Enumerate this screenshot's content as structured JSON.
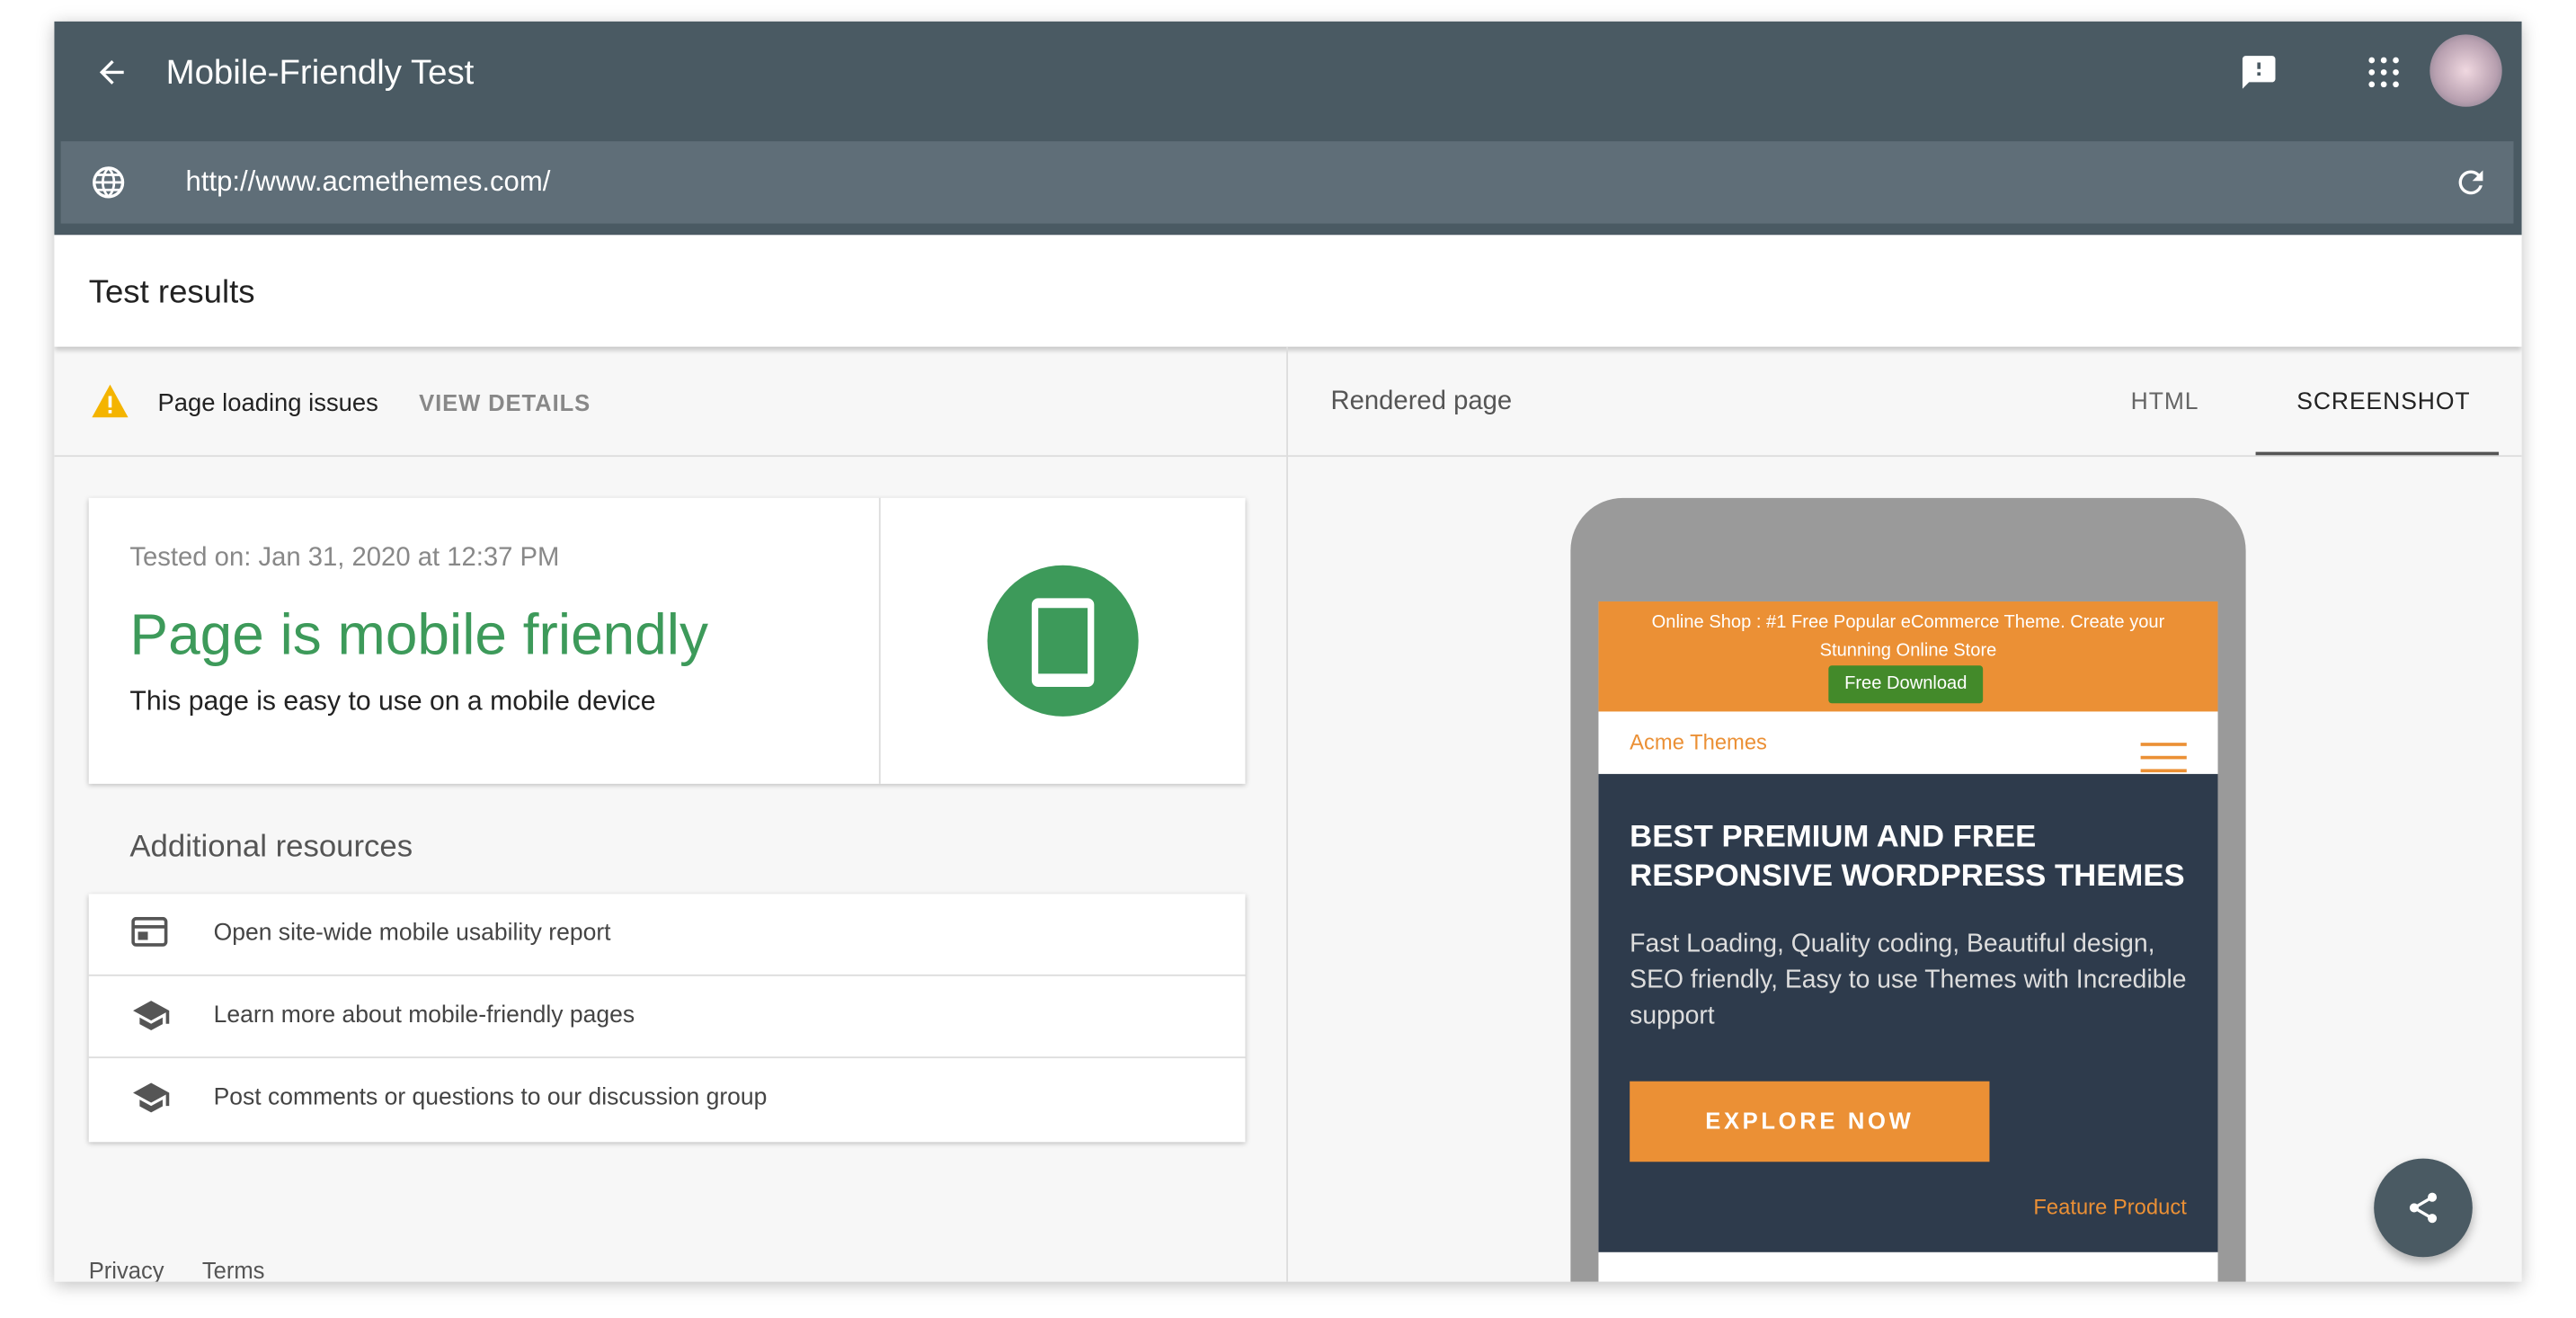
{
  "header": {
    "title": "Mobile-Friendly Test",
    "back_icon": "arrow-left-icon",
    "feedback_icon": "feedback-icon",
    "apps_icon": "apps-grid-icon"
  },
  "url_bar": {
    "value": "http://www.acmethemes.com/",
    "globe_icon": "globe-icon",
    "reload_icon": "reload-icon"
  },
  "results": {
    "title": "Test results"
  },
  "issues": {
    "label": "Page loading issues",
    "action": "VIEW DETAILS",
    "warning_color": "#f4b400"
  },
  "result_card": {
    "tested_on": "Tested on: Jan 31, 2020 at 12:37 PM",
    "headline": "Page is mobile friendly",
    "subtext": "This page is easy to use on a mobile device",
    "accent": "#3d9a5a"
  },
  "resources": {
    "title": "Additional resources",
    "items": [
      {
        "label": "Open site-wide mobile usability report",
        "icon": "report-icon"
      },
      {
        "label": "Learn more about mobile-friendly pages",
        "icon": "school-icon"
      },
      {
        "label": "Post comments or questions to our discussion group",
        "icon": "school-icon"
      }
    ]
  },
  "footer": {
    "privacy": "Privacy",
    "terms": "Terms"
  },
  "right_pane": {
    "label": "Rendered page",
    "tabs": [
      {
        "label": "HTML",
        "active": false
      },
      {
        "label": "SCREENSHOT",
        "active": true
      }
    ]
  },
  "phone": {
    "banner": "Online Shop : #1 Free Popular eCommerce Theme. Create your Stunning Online Store",
    "banner_button": "Free Download",
    "logo_alt": "Acme Themes",
    "hero_title": "BEST PREMIUM AND FREE RESPONSIVE WORDPRESS THEMES",
    "hero_text": "Fast Loading, Quality coding, Beautiful design, SEO friendly, Easy to use Themes with Incredible support",
    "hero_button": "EXPLORE NOW",
    "feature_alt": "Feature Product"
  },
  "share_icon": "share-icon"
}
